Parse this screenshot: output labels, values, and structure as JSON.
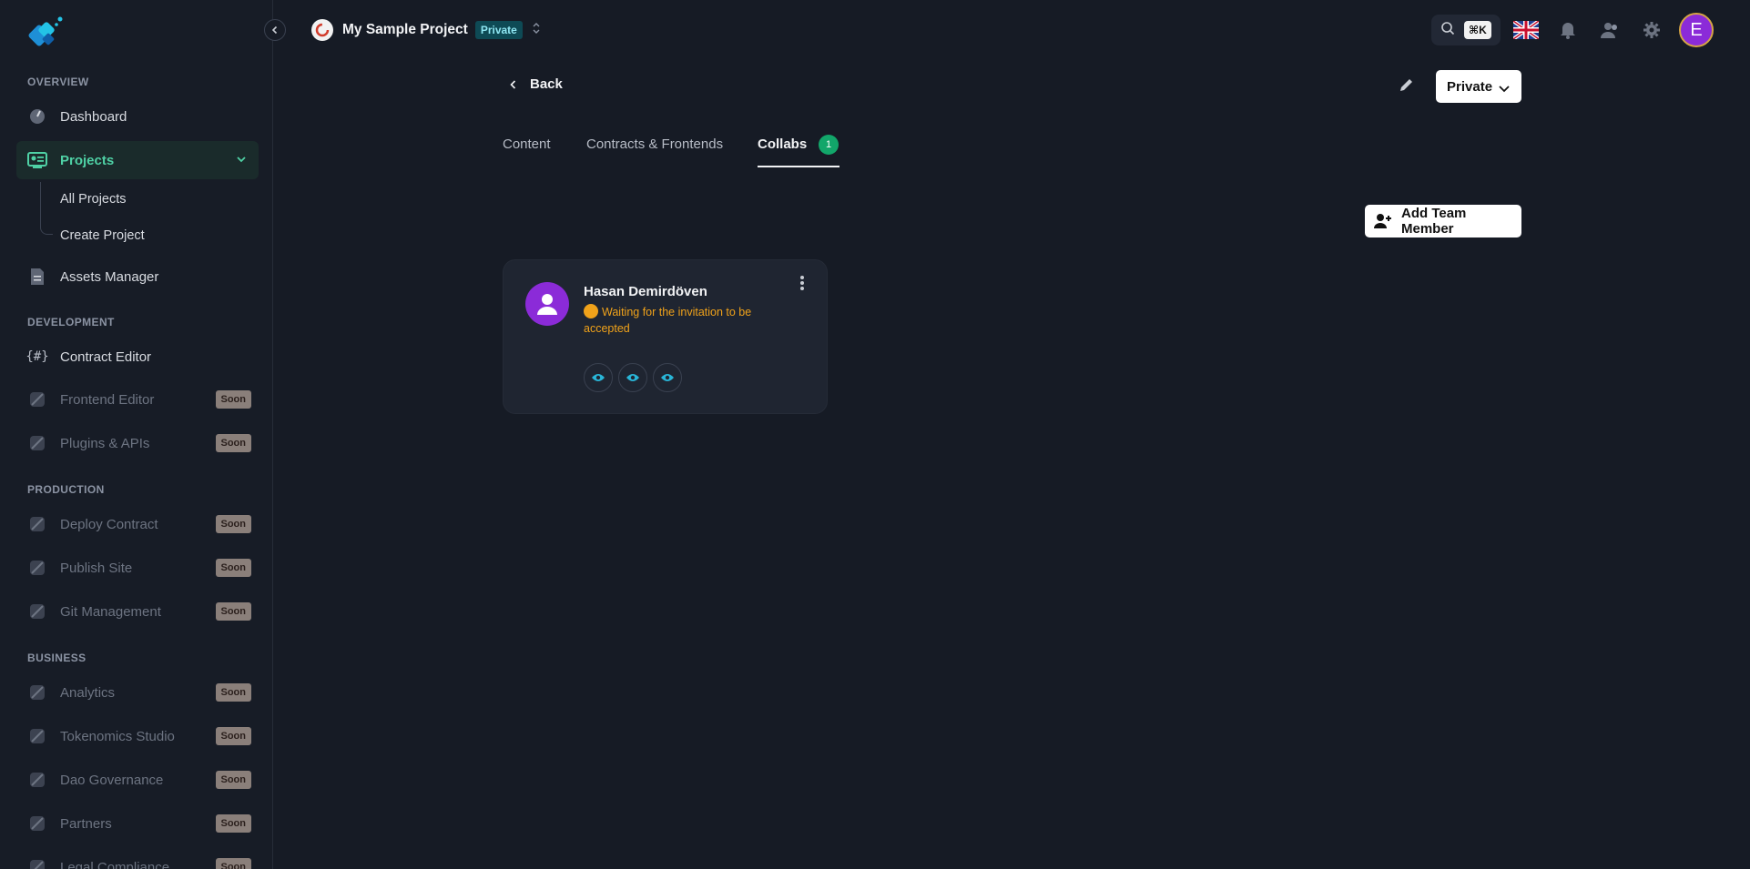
{
  "sidebar": {
    "sections": {
      "overview": "OVERVIEW",
      "development": "DEVELOPMENT",
      "production": "PRODUCTION",
      "business": "BUSINESS"
    },
    "items": {
      "dashboard": "Dashboard",
      "projects": "Projects",
      "all_projects": "All Projects",
      "create_project": "Create Project",
      "assets_manager": "Assets Manager",
      "contract_editor": "Contract Editor",
      "frontend_editor": "Frontend Editor",
      "plugins_apis": "Plugins & APIs",
      "deploy_contract": "Deploy Contract",
      "publish_site": "Publish Site",
      "git_management": "Git Management",
      "analytics": "Analytics",
      "tokenomics_studio": "Tokenomics Studio",
      "dao_governance": "Dao Governance",
      "partners": "Partners",
      "legal_compliance": "Legal Compliance"
    },
    "soon_label": "Soon"
  },
  "topbar": {
    "project_name": "My Sample Project",
    "project_visibility": "Private",
    "search_shortcut": "⌘K",
    "user_initial": "E"
  },
  "content": {
    "back_label": "Back",
    "visibility_select": "Private",
    "tabs": {
      "content": "Content",
      "contracts_frontends": "Contracts & Frontends",
      "collabs": "Collabs",
      "collabs_count": "1"
    },
    "add_member_label": "Add Team Member",
    "member": {
      "name": "Hasan Demirdöven",
      "status": "Waiting for the invitation to be accepted"
    }
  },
  "colors": {
    "background": "#161b25",
    "accent_green": "#4fd1a5",
    "warning": "#f0a21a",
    "avatar_purple": "#8b2bd8",
    "badge_teal": "#0e4a55"
  }
}
